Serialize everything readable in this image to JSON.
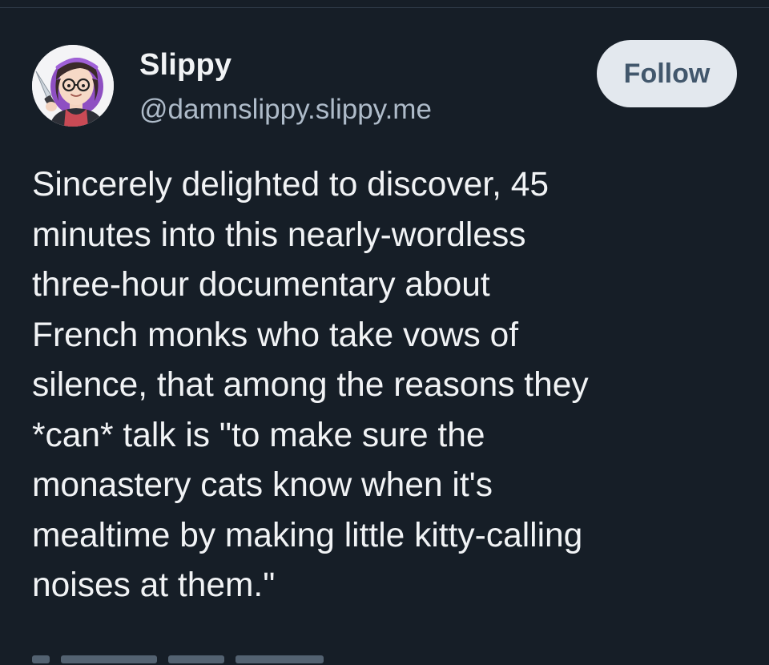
{
  "author": {
    "name": "Slippy",
    "handle": "@damnslippy.slippy.me",
    "avatar_icon": "avatar-illustration-icon"
  },
  "follow_button": {
    "label": "Follow"
  },
  "post": {
    "text": "Sincerely delighted to discover, 45\nminutes into this nearly-wordless\nthree-hour documentary about\nFrench monks who take vows of\nsilence, that among the reasons they\n*can* talk is \"to make sure the\nmonastery cats know when it's\nmealtime by making little kitty-calling\nnoises at them.\""
  },
  "colors": {
    "background": "#161e27",
    "text_primary": "#f1f3f5",
    "text_secondary": "#aebbc9",
    "button_bg": "#e3e8ee",
    "button_text": "#42576c"
  }
}
